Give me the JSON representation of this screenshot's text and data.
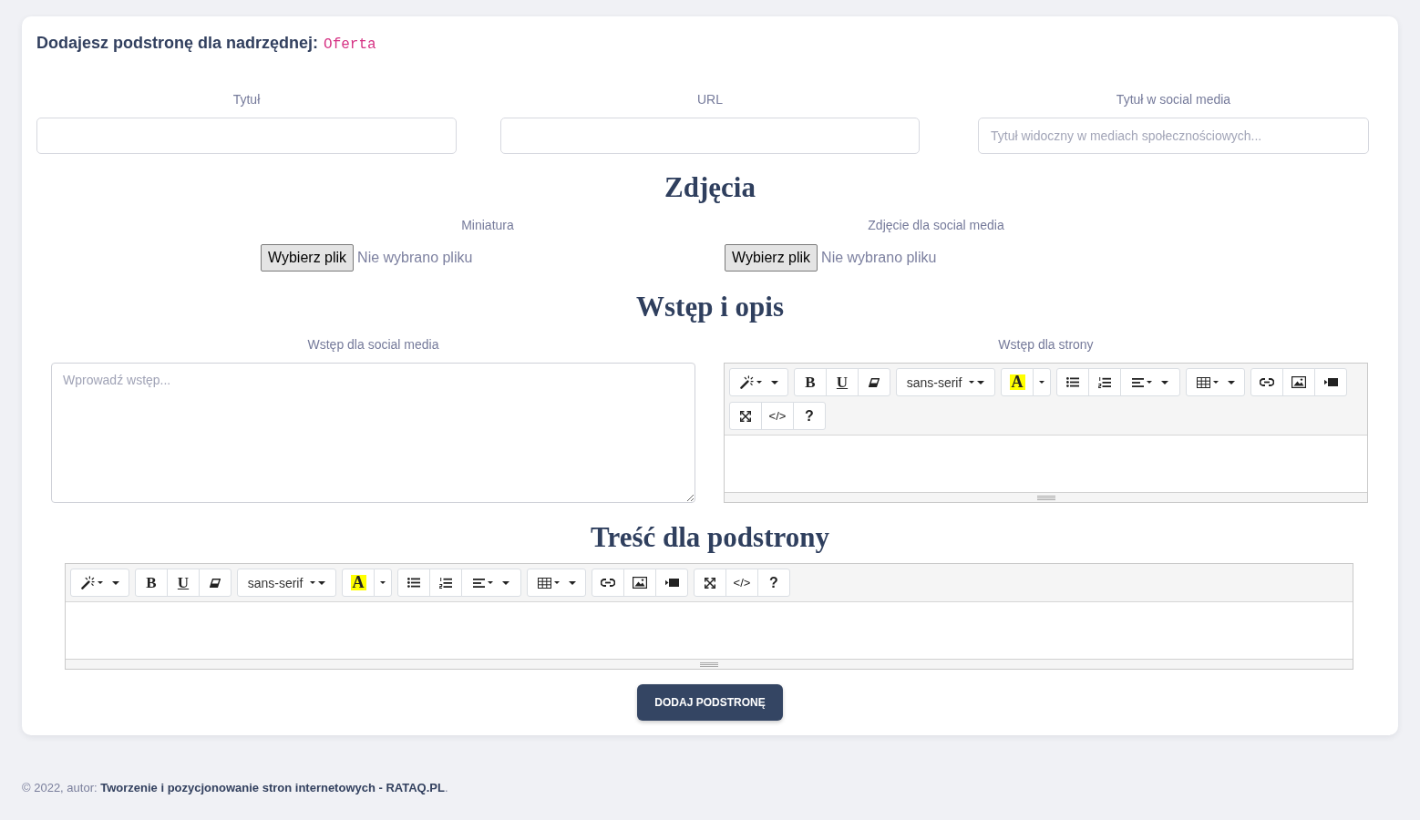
{
  "header": {
    "title": "Dodajesz podstronę dla nadrzędnej:",
    "parent_name": "Oferta"
  },
  "fields": [
    {
      "label": "Tytuł"
    },
    {
      "label": "URL"
    },
    {
      "label": "Tytuł w social media",
      "placeholder": "Tytuł widoczny w mediach społecznościowych..."
    }
  ],
  "photos": {
    "heading": "Zdjęcia",
    "inputs": [
      {
        "label": "Miniatura",
        "button": "Wybierz plik",
        "status": "Nie wybrano pliku"
      },
      {
        "label": "Zdjęcie dla social media",
        "button": "Wybierz plik",
        "status": "Nie wybrano pliku"
      }
    ]
  },
  "intro": {
    "heading": "Wstęp i opis",
    "social": {
      "label": "Wstęp dla social media",
      "placeholder": "Wprowadź wstęp..."
    },
    "page": {
      "label": "Wstęp dla strony",
      "editor": {
        "toolbar": {
          "groups": [
            {
              "buttons": [
                {
                  "kind": "style"
                }
              ]
            },
            {
              "buttons": [
                {
                  "kind": "bold",
                  "text": "B"
                },
                {
                  "kind": "underline",
                  "text": "U"
                },
                {
                  "kind": "clear"
                }
              ]
            },
            {
              "buttons": [
                {
                  "kind": "font",
                  "text": "sans-serif"
                }
              ]
            },
            {
              "buttons": [
                {
                  "kind": "color",
                  "text": "A"
                },
                {
                  "kind": "color_menu"
                }
              ]
            },
            {
              "buttons": [
                {
                  "kind": "bullets"
                },
                {
                  "kind": "numbers"
                },
                {
                  "kind": "align"
                }
              ]
            },
            {
              "buttons": [
                {
                  "kind": "table"
                }
              ]
            },
            {
              "buttons": [
                {
                  "kind": "link"
                },
                {
                  "kind": "picture"
                },
                {
                  "kind": "video"
                }
              ]
            },
            {
              "buttons": [
                {
                  "kind": "fullscreen"
                },
                {
                  "kind": "code",
                  "text": "</>"
                },
                {
                  "kind": "help",
                  "text": "?"
                }
              ]
            }
          ]
        }
      }
    }
  },
  "content": {
    "heading": "Treść dla podstrony",
    "editor": {
      "toolbar": {
        "groups": [
          {
            "buttons": [
              {
                "kind": "style"
              }
            ]
          },
          {
            "buttons": [
              {
                "kind": "bold",
                "text": "B"
              },
              {
                "kind": "underline",
                "text": "U"
              },
              {
                "kind": "clear"
              }
            ]
          },
          {
            "buttons": [
              {
                "kind": "font",
                "text": "sans-serif"
              }
            ]
          },
          {
            "buttons": [
              {
                "kind": "color",
                "text": "A"
              },
              {
                "kind": "color_menu"
              }
            ]
          },
          {
            "buttons": [
              {
                "kind": "bullets"
              },
              {
                "kind": "numbers"
              },
              {
                "kind": "align"
              }
            ]
          },
          {
            "buttons": [
              {
                "kind": "table"
              }
            ]
          },
          {
            "buttons": [
              {
                "kind": "link"
              },
              {
                "kind": "picture"
              },
              {
                "kind": "video"
              }
            ]
          },
          {
            "buttons": [
              {
                "kind": "fullscreen"
              },
              {
                "kind": "code",
                "text": "</>"
              },
              {
                "kind": "help",
                "text": "?"
              }
            ]
          }
        ]
      }
    }
  },
  "submit_button": "DODAJ PODSTRONĘ",
  "footer": {
    "text_before": "© 2022, autor:",
    "link": "Tworzenie i pozycjonowanie stron internetowych - RATAQ.PL",
    "text_after": "."
  }
}
